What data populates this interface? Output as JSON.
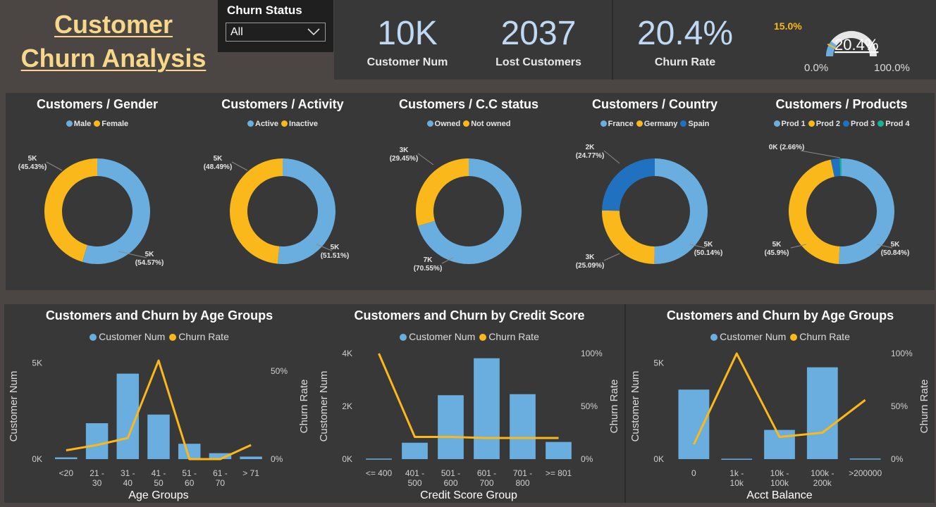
{
  "header": {
    "title_line1": "Customer",
    "title_line2": "Churn Analysis",
    "filter": {
      "label": "Churn Status",
      "value": "All"
    }
  },
  "kpis": [
    {
      "value": "10K",
      "label": "Customer Num"
    },
    {
      "value": "2037",
      "label": "Lost Customers"
    },
    {
      "value": "20.4%",
      "label": "Churn Rate"
    }
  ],
  "gauge": {
    "value": 20.4,
    "value_label": "20.4%",
    "target_label": "15.0%",
    "target": 15.0,
    "min_label": "0.0%",
    "max_label": "100.0%"
  },
  "colors": {
    "blue": "#6aaee0",
    "yellow": "#fbb81a",
    "darkblue": "#2171c1",
    "teal": "#17b394",
    "panel": "#383838",
    "bg": "#4b4643"
  },
  "donuts": [
    {
      "title": "Customers / Gender",
      "legend": [
        "Male",
        "Female"
      ],
      "slices": [
        {
          "name": "Male",
          "pct": 54.57,
          "color": "#6aaee0",
          "label_top": "5K",
          "label_bot": "(54.57%)"
        },
        {
          "name": "Female",
          "pct": 45.43,
          "color": "#fbb81a",
          "label_top": "5K",
          "label_bot": "(45.43%)"
        }
      ]
    },
    {
      "title": "Customers / Activity",
      "legend": [
        "Active",
        "Inactive"
      ],
      "slices": [
        {
          "name": "Active",
          "pct": 51.51,
          "color": "#6aaee0",
          "label_top": "5K",
          "label_bot": "(51.51%)"
        },
        {
          "name": "Inactive",
          "pct": 48.49,
          "color": "#fbb81a",
          "label_top": "5K",
          "label_bot": "(48.49%)"
        }
      ]
    },
    {
      "title": "Customers / C.C status",
      "legend": [
        "Owned",
        "Not owned"
      ],
      "slices": [
        {
          "name": "Owned",
          "pct": 70.55,
          "color": "#6aaee0",
          "label_top": "7K",
          "label_bot": "(70.55%)"
        },
        {
          "name": "Not owned",
          "pct": 29.45,
          "color": "#fbb81a",
          "label_top": "3K",
          "label_bot": "(29.45%)"
        }
      ]
    },
    {
      "title": "Customers / Country",
      "legend": [
        "France",
        "Germany",
        "Spain"
      ],
      "slices": [
        {
          "name": "France",
          "pct": 50.14,
          "color": "#6aaee0",
          "label_top": "5K",
          "label_bot": "(50.14%)"
        },
        {
          "name": "Germany",
          "pct": 25.09,
          "color": "#fbb81a",
          "label_top": "3K",
          "label_bot": "(25.09%)"
        },
        {
          "name": "Spain",
          "pct": 24.77,
          "color": "#2171c1",
          "label_top": "2K",
          "label_bot": "(24.77%)"
        }
      ]
    },
    {
      "title": "Customers / Products",
      "legend": [
        "Prod 1",
        "Prod 2",
        "Prod 3",
        "Prod 4"
      ],
      "slices": [
        {
          "name": "Prod 1",
          "pct": 50.84,
          "color": "#6aaee0",
          "label_top": "5K",
          "label_bot": "(50.84%)"
        },
        {
          "name": "Prod 2",
          "pct": 45.9,
          "color": "#fbb81a",
          "label_top": "5K",
          "label_bot": "(45.9%)"
        },
        {
          "name": "Prod 3",
          "pct": 2.66,
          "color": "#2171c1",
          "label_top": "0K (2.66%)",
          "label_bot": ""
        },
        {
          "name": "Prod 4",
          "pct": 0.6,
          "color": "#17b394",
          "label_top": "",
          "label_bot": ""
        }
      ]
    }
  ],
  "chart_data": [
    {
      "type": "bar",
      "title": "Customers and Churn by Age Groups",
      "legend": [
        "Customer Num",
        "Churn Rate"
      ],
      "xlabel": "Age Groups",
      "ylabel": "Customer Num",
      "y2label": "Churn Rate",
      "categories": [
        "<20",
        "21 - 30",
        "31 - 40",
        "41 - 50",
        "51 - 60",
        "61 - 70",
        "> 71"
      ],
      "ylim": [
        0,
        5500
      ],
      "yticks": [
        0,
        5000
      ],
      "ytick_labels": [
        "0K",
        "5K"
      ],
      "y2lim": [
        0,
        60
      ],
      "y2ticks": [
        0,
        50
      ],
      "y2tick_labels": [
        "0%",
        "50%"
      ],
      "series": [
        {
          "name": "Customer Num",
          "values": [
            90,
            1870,
            4450,
            2320,
            800,
            310,
            130
          ]
        },
        {
          "name": "Churn Rate",
          "values": [
            5,
            8,
            12,
            56,
            0,
            0,
            8
          ]
        }
      ]
    },
    {
      "type": "bar",
      "title": "Customers and Churn by Credit Score",
      "legend": [
        "Customer Num",
        "Churn Rate"
      ],
      "xlabel": "Credit Score Group",
      "ylabel": "Customer Num",
      "y2label": "Churn Rate",
      "categories": [
        "<= 400",
        "401 - 500",
        "501 - 600",
        "601 - 700",
        "701 - 800",
        ">= 801"
      ],
      "ylim": [
        0,
        4000
      ],
      "yticks": [
        0,
        2000,
        4000
      ],
      "ytick_labels": [
        "0K",
        "2K",
        "4K"
      ],
      "y2lim": [
        0,
        100
      ],
      "y2ticks": [
        0,
        50,
        100
      ],
      "y2tick_labels": [
        "0%",
        "50%",
        "100%"
      ],
      "series": [
        {
          "name": "Customer Num",
          "values": [
            20,
            620,
            2420,
            3820,
            2460,
            650
          ]
        },
        {
          "name": "Churn Rate",
          "values": [
            100,
            21,
            21,
            20,
            20,
            20
          ]
        }
      ]
    },
    {
      "type": "bar",
      "title": "Customers and Churn by Age Groups",
      "legend": [
        "Customer Num",
        "Churn Rate"
      ],
      "xlabel": "Acct Balance",
      "ylabel": "Customer Num",
      "y2label": "Churn Rate",
      "categories": [
        "0",
        "1k - 10k",
        "10k - 100k",
        "100k - 200k",
        ">200000"
      ],
      "ylim": [
        0,
        5500
      ],
      "yticks": [
        0,
        5000
      ],
      "ytick_labels": [
        "0K",
        "5K"
      ],
      "y2lim": [
        0,
        100
      ],
      "y2ticks": [
        0,
        50,
        100
      ],
      "y2tick_labels": [
        "0%",
        "50%",
        "100%"
      ],
      "series": [
        {
          "name": "Customer Num",
          "values": [
            3620,
            20,
            1520,
            4780,
            30
          ]
        },
        {
          "name": "Churn Rate",
          "values": [
            14,
            100,
            21,
            25,
            56
          ]
        }
      ]
    }
  ]
}
